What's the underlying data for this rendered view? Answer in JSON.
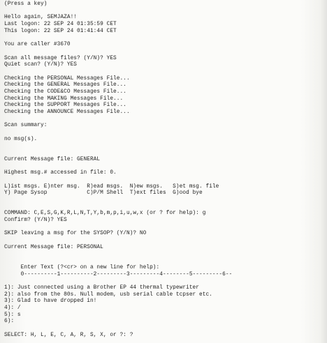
{
  "printout": {
    "lines": [
      "(Press a key)",
      "",
      "Hello again, SEMJAZA!!",
      "Last logon: 22 SEP 24 01:35:59 CET",
      "This logon: 22 SEP 24 01:41:44 CET",
      "",
      "You are caller #3670",
      "",
      "Scan all message files? (Y/N)? YES",
      "Quiet scan? (Y/N)? YES",
      "",
      "Checking the PERSONAL Messages File...",
      "Checking the GENERAL Messages File...",
      "Checking the CODE&CO Messages File...",
      "Checking the MAKING Messages File...",
      "Checking the SUPPORT Messages File...",
      "Checking the ANNOUNCE Messages File...",
      "",
      "Scan summary:",
      "",
      "no msg(s).",
      "",
      "",
      "Current Message file: GENERAL",
      "",
      "Highest msg.# accessed in file: 0.",
      "",
      "L)ist msgs. E)nter msg.  R)ead msgs.  N)ew msgs.   S)et msg. file",
      "Y) Page Sysop            C)P/M Shell  T)ext files  G)ood bye",
      "",
      "",
      "COMMAND: C,E,S,G,K,R,L,N,T,Y,b,m,p,i,u,w,x (or ? for help): g",
      "Confirm? (Y/N)? YES",
      "",
      "SKIP leaving a msg for the SYSOP? (Y/N)? NO",
      "",
      "Current Message file: PERSONAL",
      "",
      "",
      "     Enter Text (?<cr> on a new line for help):",
      "     0----------1----------2---------3---------4--------5---------6--",
      "",
      "1): Just connected using a Brother EP 44 thermal typewriter",
      "2): also from the 80s. Null modem, usb serial cable tcpser etc.",
      "3): Glad to have dropped in!",
      "4): /",
      "5): s",
      "6):",
      "",
      "SELECT: H, L, E, C, A, R, S, X, or ?: ?"
    ]
  }
}
